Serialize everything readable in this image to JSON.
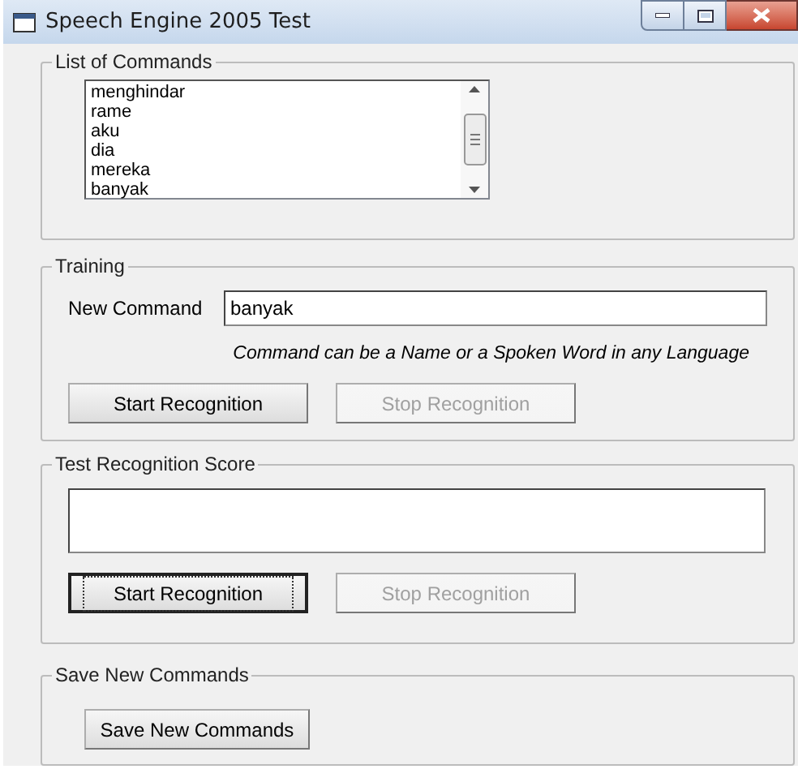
{
  "window": {
    "title": "Speech Engine 2005 Test"
  },
  "commands_group": {
    "label": "List of Commands",
    "items": [
      "menghindar",
      "rame",
      "aku",
      "dia",
      "mereka",
      "banyak"
    ]
  },
  "training": {
    "label": "Training",
    "field_label": "New Command",
    "value": "banyak",
    "hint": "Command can be a Name or a Spoken Word in any Language",
    "buttons": [
      {
        "label": "Start Recognition",
        "disabled": false,
        "focused": false
      },
      {
        "label": "Stop Recognition",
        "disabled": true,
        "focused": false
      }
    ]
  },
  "test": {
    "label": "Test Recognition Score",
    "buttons": [
      {
        "label": "Start Recognition",
        "disabled": false,
        "focused": true
      },
      {
        "label": "Stop Recognition",
        "disabled": true,
        "focused": false
      }
    ]
  },
  "save": {
    "label": "Save New Commands",
    "buttons": [
      {
        "label": "Save New Commands",
        "disabled": false,
        "focused": false
      }
    ]
  }
}
